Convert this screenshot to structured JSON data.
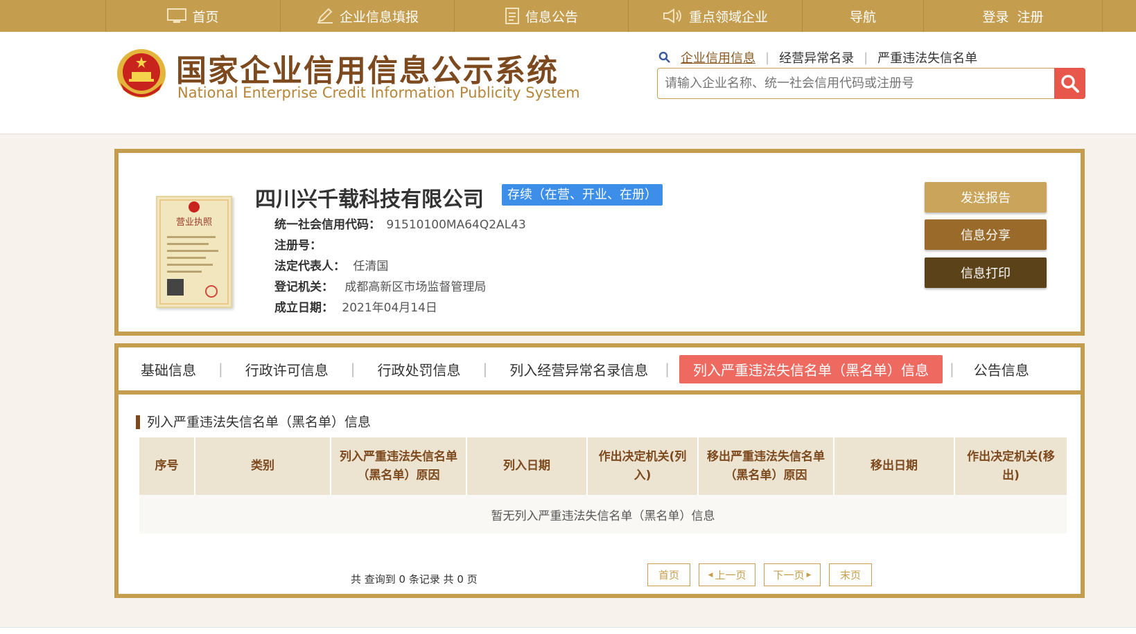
{
  "nav": {
    "home": "首页",
    "report": "企业信息填报",
    "notice": "信息公告",
    "focus": "重点领域企业",
    "guide": "导航",
    "login": "登录",
    "register": "注册"
  },
  "header": {
    "title": "国家企业信用信息公示系统",
    "subtitle": "National Enterprise Credit Information Publicity System",
    "search_tabs": [
      "企业信用信息",
      "经营异常名录",
      "严重违法失信名单"
    ],
    "search_placeholder": "请输入企业名称、统一社会信用代码或注册号"
  },
  "company": {
    "name": "四川兴千载科技有限公司",
    "status": "存续（在营、开业、在册）",
    "fields": [
      {
        "label": "统一社会信用代码：",
        "value": "91510100MA64Q2AL43"
      },
      {
        "label": "注册号：",
        "value": ""
      },
      {
        "label": "法定代表人：",
        "value": "任清国"
      },
      {
        "label": "登记机关：",
        "value": "成都高新区市场监督管理局"
      },
      {
        "label": "成立日期：",
        "value": "2021年04月14日"
      }
    ],
    "license_label": "营业执照",
    "actions": {
      "send": "发送报告",
      "share": "信息分享",
      "print": "信息打印"
    }
  },
  "tabs": [
    "基础信息",
    "行政许可信息",
    "行政处罚信息",
    "列入经营异常名录信息",
    "列入严重违法失信名单（黑名单）信息",
    "公告信息"
  ],
  "active_tab": 4,
  "section": {
    "title": "列入严重违法失信名单（黑名单）信息",
    "columns": [
      "序号",
      "类别",
      "列入严重违法失信名单（黑名单）原因",
      "列入日期",
      "作出决定机关(列入)",
      "移出严重违法失信名单（黑名单）原因",
      "移出日期",
      "作出决定机关(移出)"
    ],
    "empty_text": "暂无列入严重违法失信名单（黑名单）信息"
  },
  "pager": {
    "summary": "共 查询到 0 条记录 共 0 页",
    "first": "首页",
    "prev": "上一页",
    "next": "下一页",
    "last": "末页"
  },
  "colors": {
    "gold": "#c49d4f",
    "brown": "#7c4a1e",
    "status": "#3c8ee8",
    "active_tab": "#ee6a61",
    "send": "#c9a45a",
    "share": "#9a6a2a",
    "print": "#5c4218",
    "search_btn": "#e8584a"
  }
}
